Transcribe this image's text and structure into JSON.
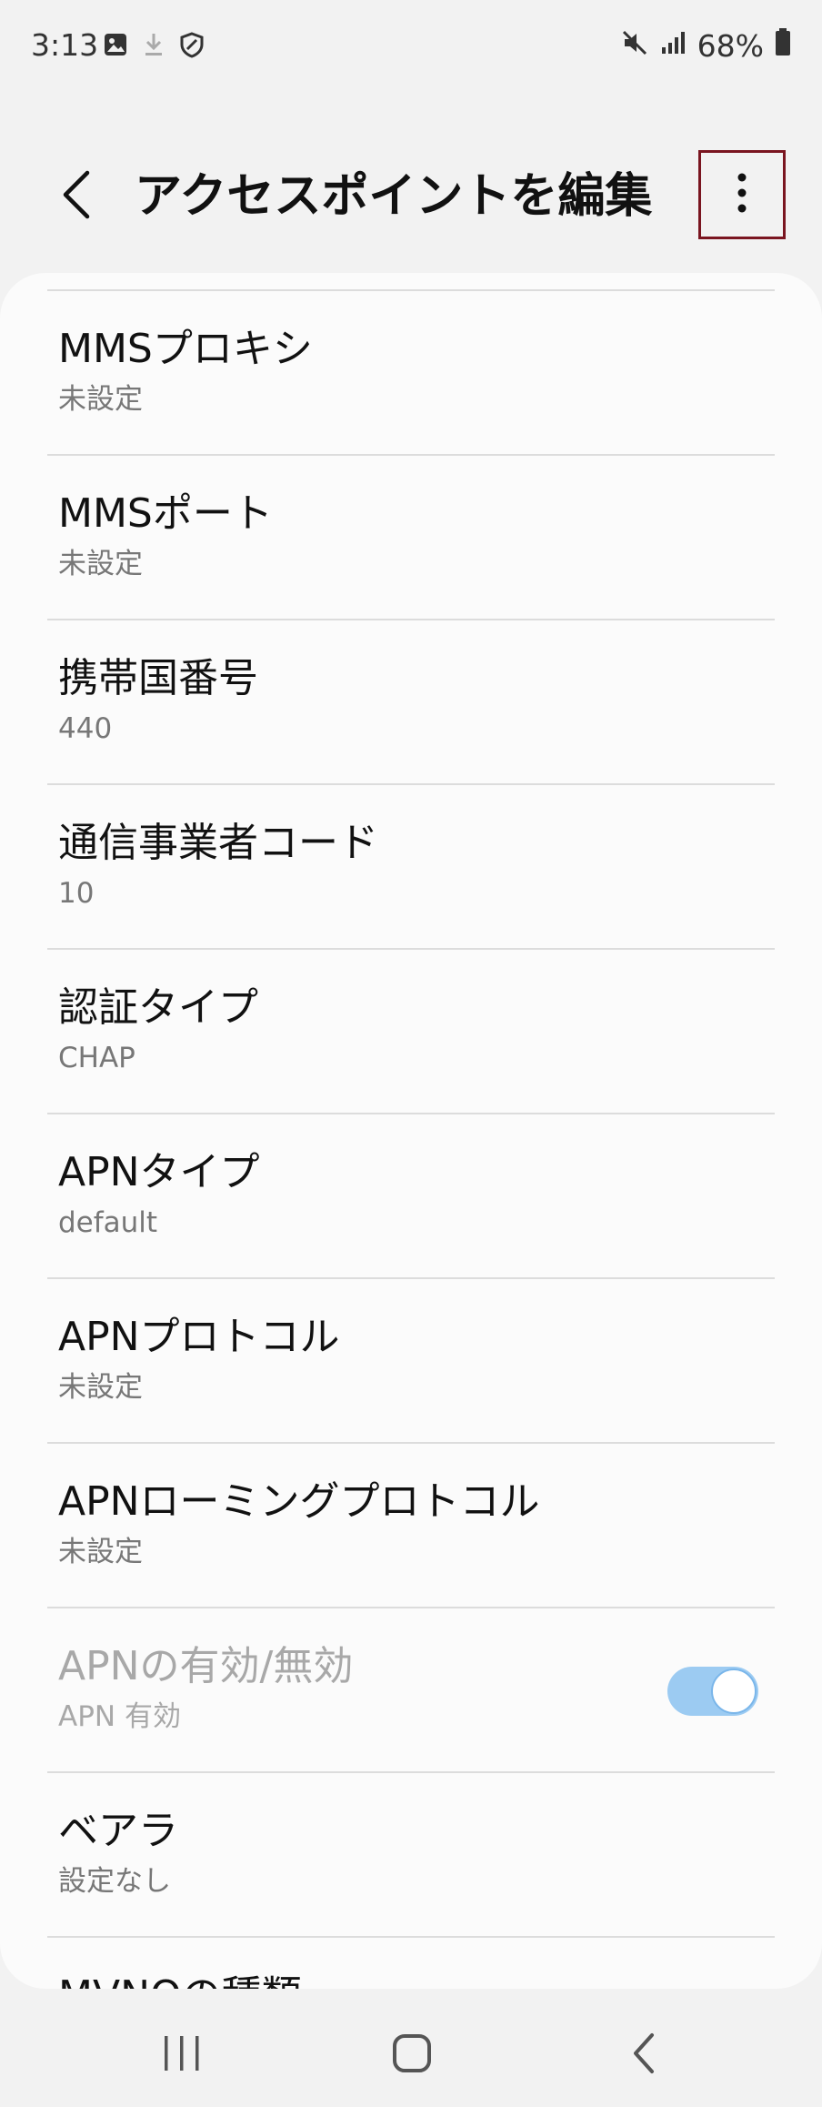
{
  "status_bar": {
    "time": "3:13",
    "battery": "68%",
    "left_icons": [
      "image-icon",
      "download-icon",
      "shield-icon"
    ],
    "right_icons": [
      "mute-icon",
      "signal-icon",
      "battery-icon"
    ]
  },
  "header": {
    "title": "アクセスポイントを編集",
    "back_icon": "back-arrow-icon",
    "more_icon": "more-options-icon",
    "highlight_color": "#7a1520"
  },
  "settings": [
    {
      "label": "MMSプロキシ",
      "value": "未設定"
    },
    {
      "label": "MMSポート",
      "value": "未設定"
    },
    {
      "label": "携帯国番号",
      "value": "440"
    },
    {
      "label": "通信事業者コード",
      "value": "10"
    },
    {
      "label": "認証タイプ",
      "value": "CHAP"
    },
    {
      "label": "APNタイプ",
      "value": "default"
    },
    {
      "label": "APNプロトコル",
      "value": "未設定"
    },
    {
      "label": "APNローミングプロトコル",
      "value": "未設定"
    },
    {
      "label": "APNの有効/無効",
      "value": "APN 有効",
      "toggle": true,
      "toggle_on": true,
      "disabled": true
    },
    {
      "label": "ベアラ",
      "value": "設定なし"
    },
    {
      "label": "MVNOの種類",
      "value": ""
    }
  ],
  "toggle_color": "#9ccbf2",
  "nav_bar": {
    "icons": [
      "recent-apps-icon",
      "home-icon",
      "back-icon"
    ]
  }
}
